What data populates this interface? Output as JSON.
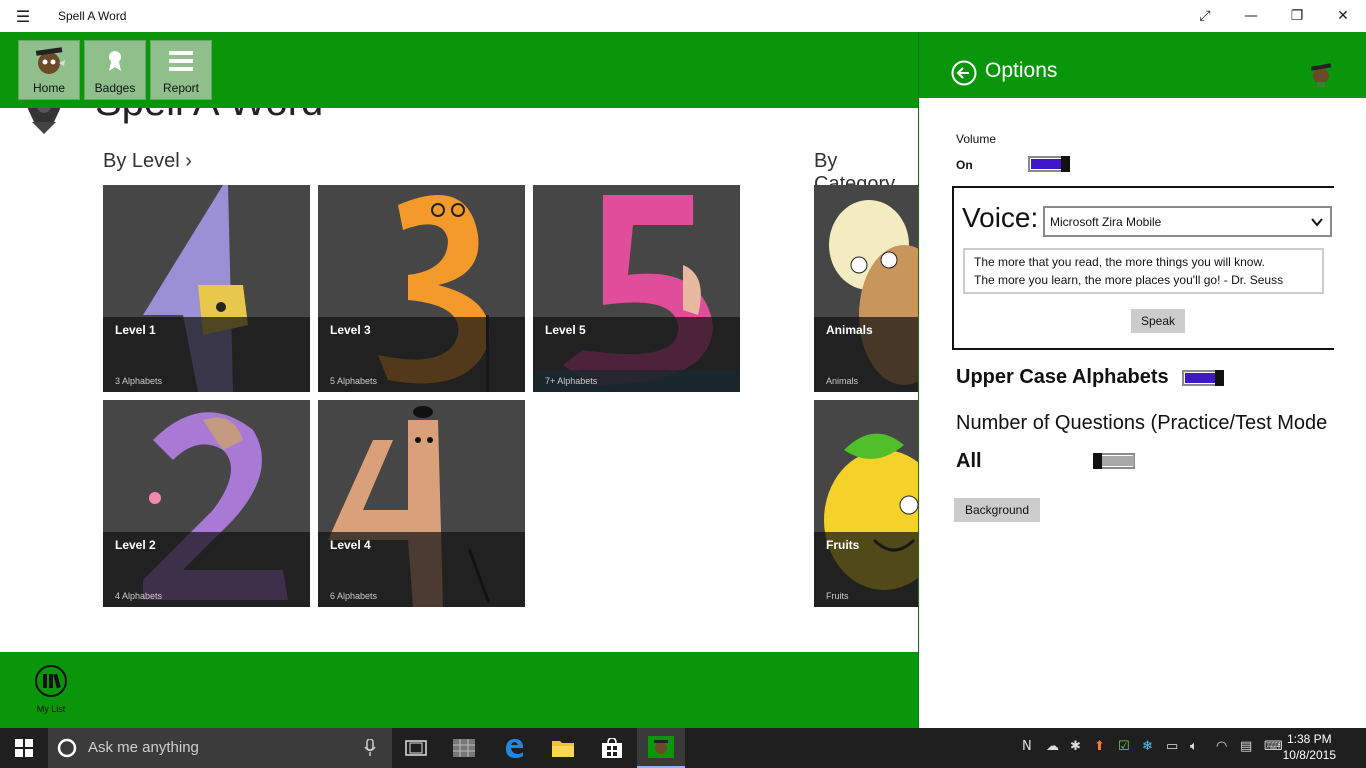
{
  "window": {
    "title": "Spell A Word",
    "menu_icon": "hamburger-icon"
  },
  "nav": {
    "home_label": "Home",
    "badges_label": "Badges",
    "report_label": "Report"
  },
  "main": {
    "app_title": "Spell A Word",
    "by_level_heading": "By Level ›",
    "by_category_heading": "By Category",
    "level_tiles": [
      {
        "name": "Level 1",
        "sub": "3 Alphabets"
      },
      {
        "name": "Level 3",
        "sub": "5 Alphabets"
      },
      {
        "name": "Level 5",
        "sub": "7+ Alphabets"
      },
      {
        "name": "Level 2",
        "sub": "4 Alphabets"
      },
      {
        "name": "Level 4",
        "sub": "6 Alphabets"
      }
    ],
    "category_tiles": [
      {
        "name": "Animals",
        "sub": "Animals"
      },
      {
        "name": "Fruits",
        "sub": "Fruits"
      }
    ]
  },
  "bottom_bar": {
    "mylist_label": "My List"
  },
  "options": {
    "title": "Options",
    "volume_label": "Volume",
    "volume_state": "On",
    "volume_on": true,
    "voice_label": "Voice:",
    "voice_selected": "Microsoft Zira Mobile",
    "voice_text_line1": "The more that you read, the more things you will know.",
    "voice_text_line2": "The more you learn, the more places you'll go! - Dr. Seuss",
    "speak_label": "Speak",
    "uppercase_label": "Upper Case Alphabets",
    "uppercase_on": true,
    "questions_label": "Number of Questions (Practice/Test Mode",
    "questions_value": "All",
    "questions_toggle_on": false,
    "background_label": "Background",
    "accent_color": "#0a960a",
    "toggle_color": "#3d17c8"
  },
  "taskbar": {
    "search_placeholder": "Ask me anything",
    "time": "1:38 PM",
    "date": "10/8/2015"
  }
}
